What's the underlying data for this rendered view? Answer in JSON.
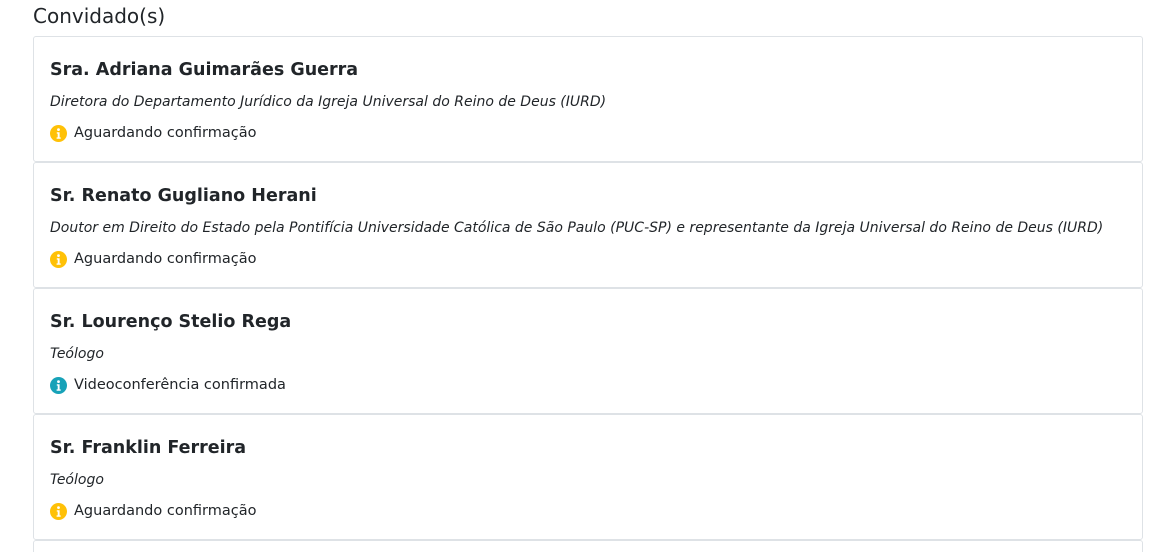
{
  "section": {
    "title": "Convidado(s)"
  },
  "colors": {
    "pending": "#ffc107",
    "confirmed": "#17a2b8",
    "border": "#dee2e6",
    "text": "#212529"
  },
  "guests": [
    {
      "name": "Sra. Adriana Guimarães Guerra",
      "role": "Diretora do Departamento Jurídico da Igreja Universal do Reino de Deus (IURD)",
      "status": "Aguardando confirmação",
      "status_icon": "info-circle-icon"
    },
    {
      "name": "Sr. Renato Gugliano Herani",
      "role": "Doutor em Direito do Estado pela Pontifícia Universidade Católica de São Paulo (PUC-SP) e representante da Igreja Universal do Reino de Deus (IURD)",
      "status": "Aguardando confirmação",
      "status_icon": "info-circle-icon"
    },
    {
      "name": "Sr. Lourenço Stelio Rega",
      "role": "Teólogo",
      "status": "Videoconferência confirmada",
      "status_icon": "info-circle-icon"
    },
    {
      "name": "Sr. Franklin Ferreira",
      "role": "Teólogo",
      "status": "Aguardando confirmação",
      "status_icon": "info-circle-icon"
    }
  ]
}
